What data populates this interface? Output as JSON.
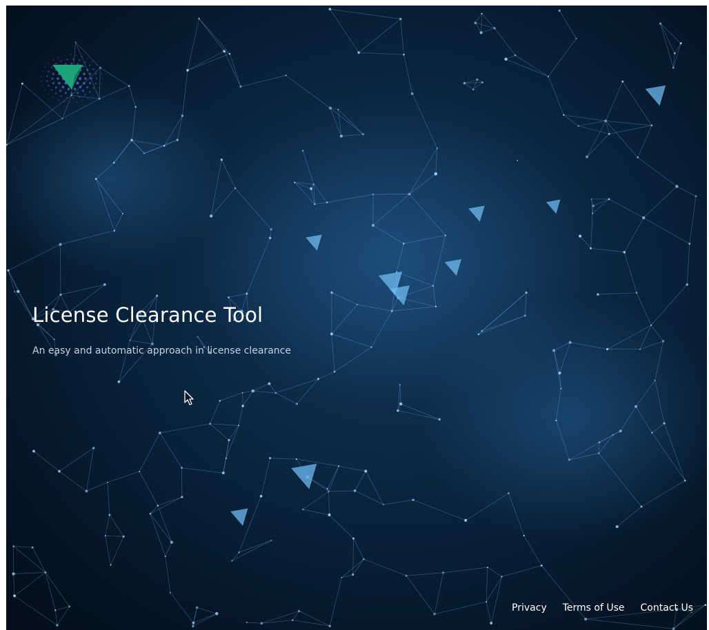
{
  "hero": {
    "title": "License Clearance Tool",
    "subtitle": "An easy and automatic approach in license clearance"
  },
  "footer": {
    "links": [
      {
        "label": "Privacy"
      },
      {
        "label": "Terms of Use"
      },
      {
        "label": "Contact Us"
      }
    ]
  },
  "theme": {
    "background": "#06182b",
    "network_color": "#7fc4ff",
    "logo_arrow": "#1fa37a",
    "logo_dots": "#4f6fd8"
  },
  "icons": {
    "logo": "paper-plane-arrow-icon",
    "cursor": "mouse-pointer-icon"
  }
}
